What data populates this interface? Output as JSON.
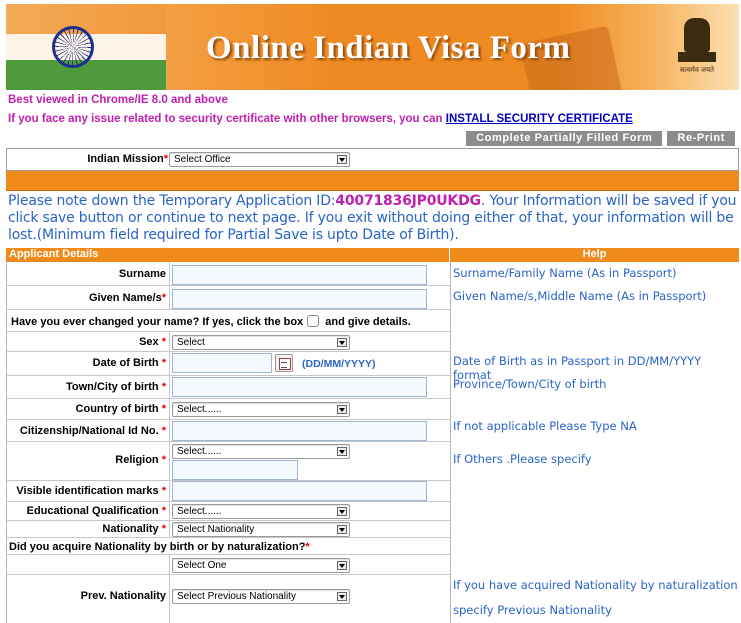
{
  "banner": {
    "title": "Online Indian Visa Form",
    "motto": "सत्यमेव जयते"
  },
  "notices": {
    "browser": "Best viewed in Chrome/IE 8.0 and above",
    "security_text": "If you face any issue related to security certificate with other browsers, you can ",
    "security_link": "INSTALL SECURITY CERTIFICATE"
  },
  "top_buttons": {
    "partial": "Complete Partially Filled Form",
    "reprint": "Re-Print"
  },
  "mission": {
    "label": "Indian Mission",
    "value": "Select Office"
  },
  "temp_note": {
    "prefix": "Please note down the Temporary Application ID:",
    "app_id": "40071836JP0UKDG",
    "suffix": ". Your Information will be saved if you click save button or continue to next page. If you exit without doing either of that, your information will be lost.(Minimum field required for Partial Save is upto Date of Birth)."
  },
  "headers": {
    "applicant": "Applicant Details",
    "help": "Help"
  },
  "fields": {
    "surname": "Surname",
    "given": "Given Name/s",
    "changed_name": "Have you ever changed your name? If yes, click the box",
    "changed_name_tail": "and give details.",
    "sex": "Sex",
    "sex_value": "Select",
    "dob": "Date of Birth",
    "dob_format": "(DD/MM/YYYY)",
    "town": "Town/City of birth",
    "country": "Country of birth",
    "country_value": "Select......",
    "citizenship": "Citizenship/National Id No.",
    "religion": "Religion",
    "religion_value": "Select......",
    "marks": "Visible identification marks",
    "education": "Educational Qualification",
    "education_value": "Select......",
    "nationality": "Nationality",
    "nationality_value": "Select Nationality",
    "acquire": "Did you acquire Nationality by birth or by naturalization?",
    "acquire_value": "Select One",
    "prev_nationality": "Prev. Nationality",
    "prev_nationality_value": "Select Previous Nationality"
  },
  "help": {
    "surname": "Surname/Family Name (As in Passport)",
    "given": "Given Name/s,Middle Name (As in Passport)",
    "dob": "Date of Birth as in Passport in DD/MM/YYYY format",
    "town": "Province/Town/City of birth",
    "citizenship": "If not applicable Please Type NA",
    "religion": "If Others .Please specify",
    "nationality_1": "If you have acquired Nationality by naturalization",
    "nationality_2": "specify Previous Nationality"
  },
  "colors": {
    "saffron": "#f08a1a",
    "link_blue": "#2a64c6",
    "notice_magenta": "#c01fb0",
    "required_red": "#ee0000"
  }
}
